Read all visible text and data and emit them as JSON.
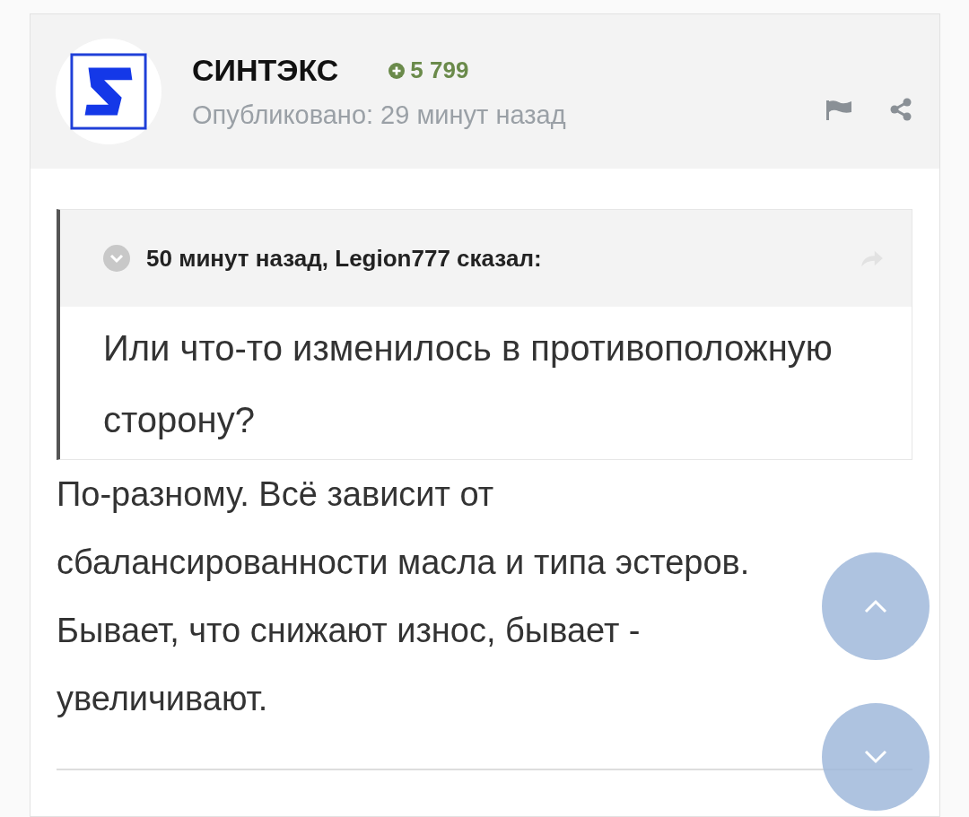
{
  "author": {
    "name": "СИНТЭКС",
    "reputation": "5 799",
    "published": "Опубликовано: 29 минут назад"
  },
  "quote": {
    "header": "50 минут назад, Legion777 сказал:",
    "text": "Или что-то изменилось в противоположную сторону?"
  },
  "body": "По-разному. Всё зависит от сбалансированности масла и типа эстеров. Бывает, что снижают износ, бывает - увеличивают."
}
